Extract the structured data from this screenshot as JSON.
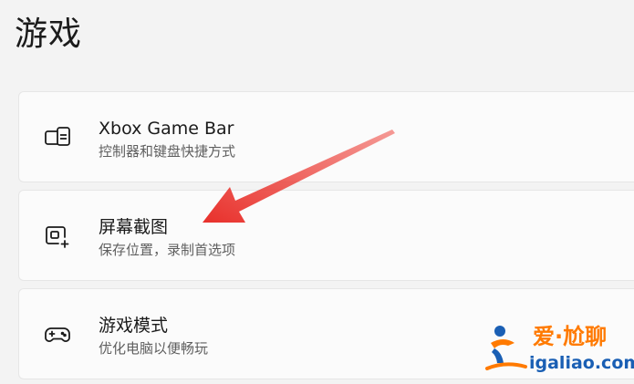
{
  "page": {
    "title": "游戏"
  },
  "settings": [
    {
      "icon": "game-bar-icon",
      "title": "Xbox Game Bar",
      "subtitle": "控制器和键盘快捷方式"
    },
    {
      "icon": "screenshot-icon",
      "title": "屏幕截图",
      "subtitle": "保存位置，录制首选项"
    },
    {
      "icon": "gamepad-icon",
      "title": "游戏模式",
      "subtitle": "优化电脑以便畅玩"
    }
  ],
  "annotation": {
    "arrow_color": "#e8302b"
  },
  "watermark": {
    "brand": "爱·尬聊",
    "url": "igaliao.com"
  }
}
